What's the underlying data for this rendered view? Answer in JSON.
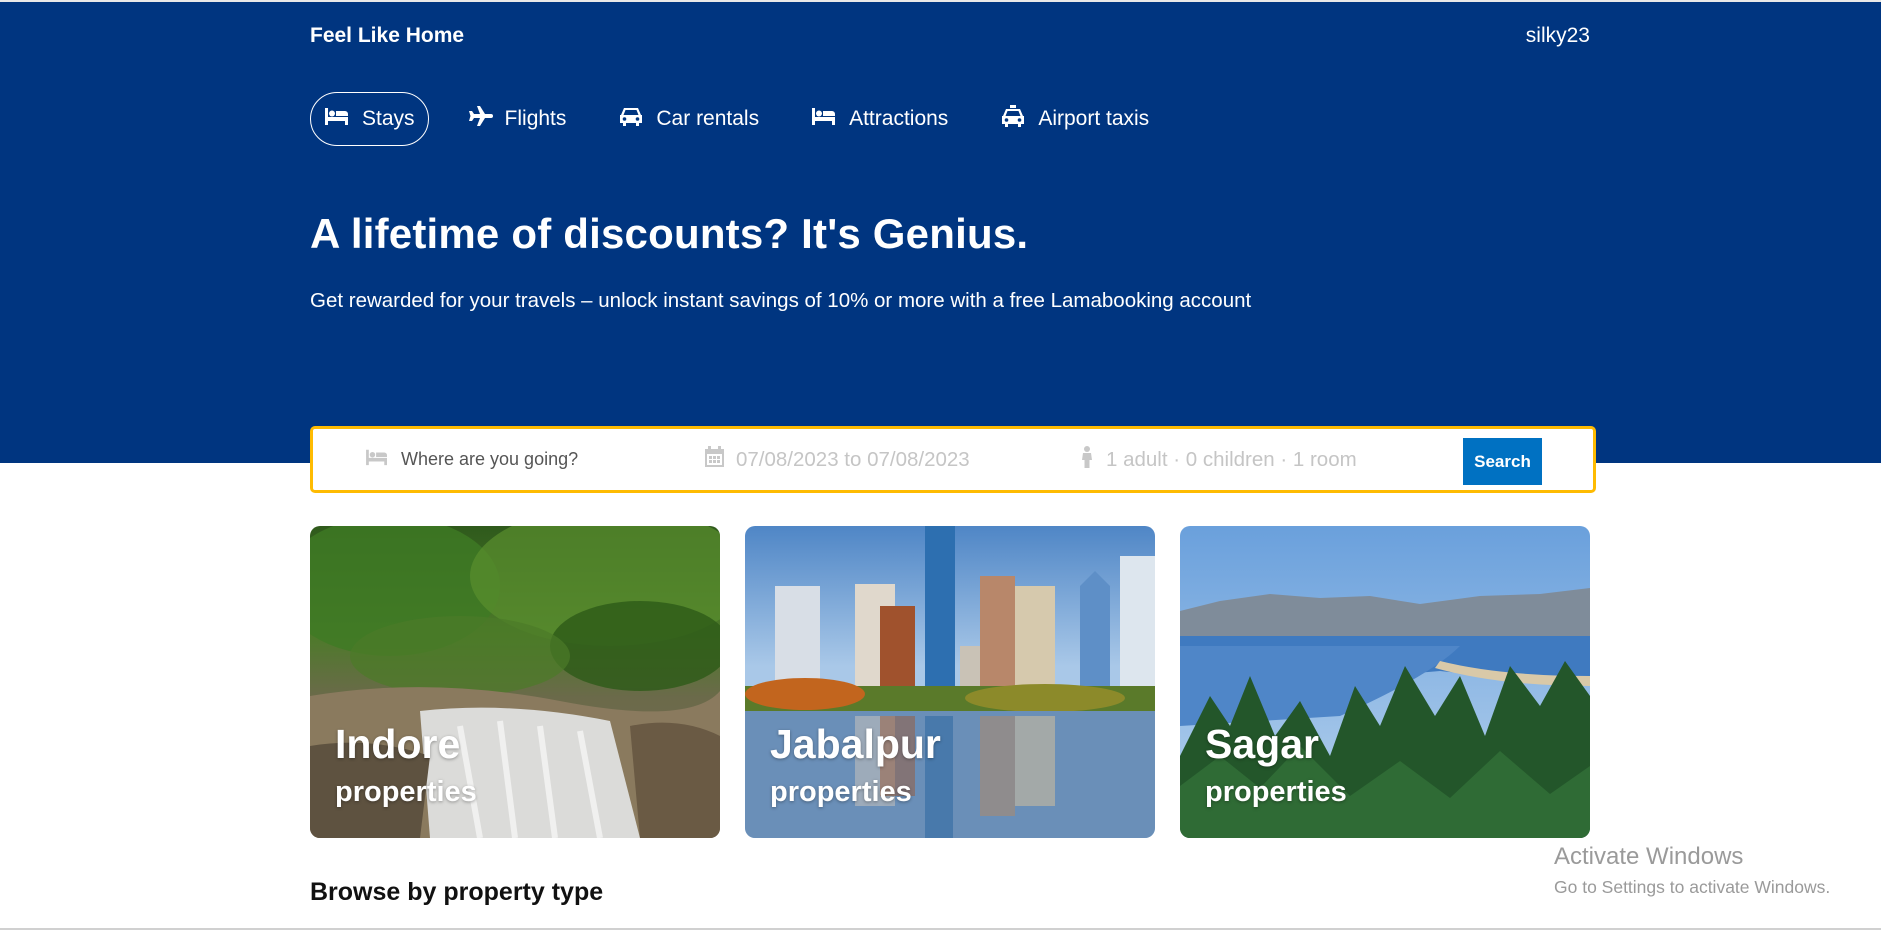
{
  "header": {
    "brand": "Feel Like Home",
    "username": "silky23",
    "background_color": "#003580"
  },
  "nav": {
    "items": [
      {
        "label": "Stays",
        "icon": "bed-icon",
        "active": true
      },
      {
        "label": "Flights",
        "icon": "plane-icon",
        "active": false
      },
      {
        "label": "Car rentals",
        "icon": "car-icon",
        "active": false
      },
      {
        "label": "Attractions",
        "icon": "bed-icon",
        "active": false
      },
      {
        "label": "Airport taxis",
        "icon": "taxi-icon",
        "active": false
      }
    ]
  },
  "hero": {
    "title": "A lifetime of discounts? It's Genius.",
    "subtitle": "Get rewarded for your travels – unlock instant savings of 10% or more with a free Lamabooking account"
  },
  "search": {
    "destination_placeholder": "Where are you going?",
    "dates": "07/08/2023 to 07/08/2023",
    "guests": "1 adult · 0 children · 1 room",
    "button_label": "Search",
    "border_color": "#febb02",
    "button_color": "#0071c2"
  },
  "featured": [
    {
      "city": "Indore",
      "label": "properties"
    },
    {
      "city": "Jabalpur",
      "label": "properties"
    },
    {
      "city": "Sagar",
      "label": "properties"
    }
  ],
  "browse": {
    "title": "Browse by property type"
  },
  "watermark": {
    "line1": "Activate Windows",
    "line2": "Go to Settings to activate Windows."
  }
}
